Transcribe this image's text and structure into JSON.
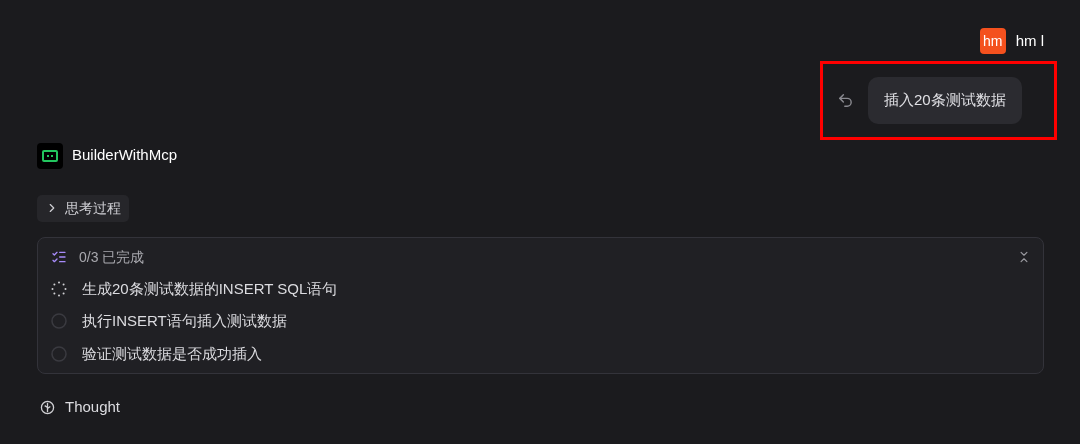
{
  "user": {
    "avatar": "hm",
    "name": "hm l"
  },
  "user_message": {
    "text": "插入20条测试数据",
    "highlighted": true
  },
  "assistant": {
    "name": "BuilderWithMcp"
  },
  "thinking": {
    "label": "思考过程",
    "expanded": false
  },
  "tasks": {
    "progress": "0/3 已完成",
    "expanded": true,
    "items": [
      {
        "kind": "in_progress",
        "text": "生成20条测试数据的INSERT SQL语句"
      },
      {
        "kind": "pending",
        "text": "执行INSERT语句插入测试数据"
      },
      {
        "kind": "pending",
        "text": "验证测试数据是否成功插入"
      }
    ]
  },
  "thought": {
    "label": "Thought"
  }
}
